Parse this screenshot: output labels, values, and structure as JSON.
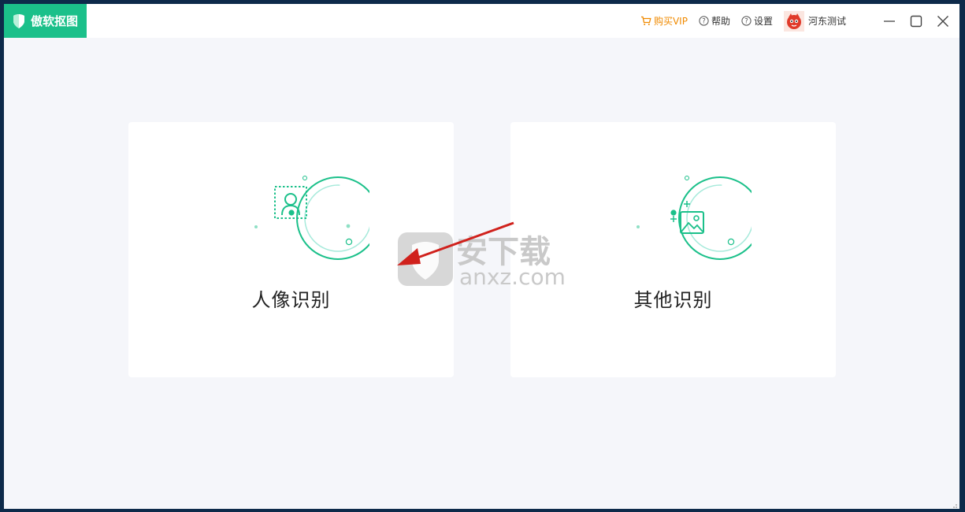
{
  "app": {
    "title": "傲软抠图",
    "brand_color": "#1bc08a"
  },
  "header": {
    "buy_vip": "购买VIP",
    "help": "帮助",
    "settings": "设置",
    "username": "河东测试",
    "vip_color": "#f08a00"
  },
  "cards": [
    {
      "label": "人像识别",
      "icon": "portrait-recognition-icon"
    },
    {
      "label": "其他识别",
      "icon": "image-recognition-icon"
    }
  ],
  "watermark": {
    "text_cn": "安下载",
    "text_en": "anxz.com"
  }
}
